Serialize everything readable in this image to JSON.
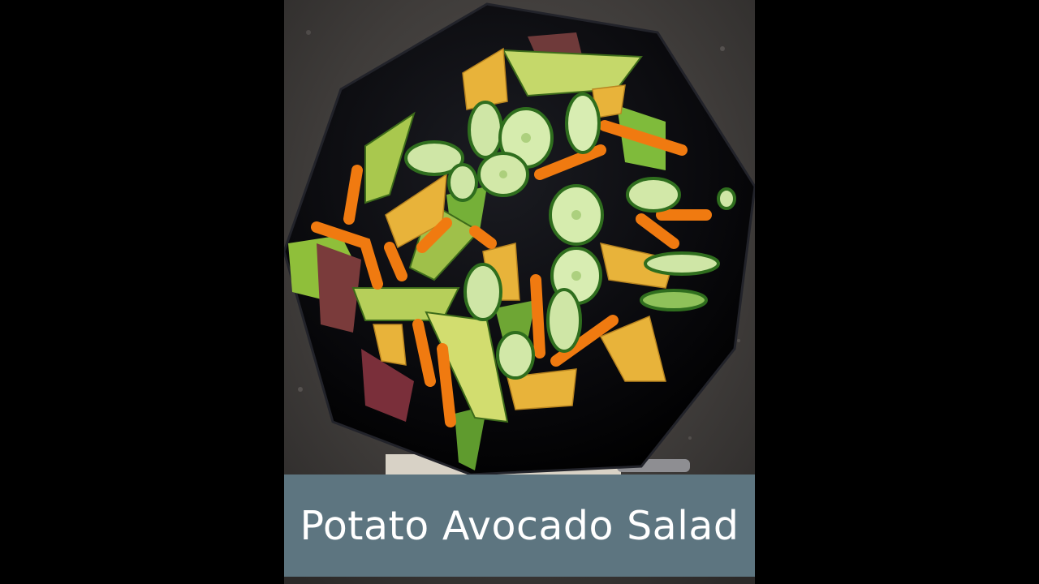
{
  "caption": {
    "title": "Potato Avocado Salad"
  },
  "colors": {
    "background": "#000000",
    "caption_bar": "#5d7580",
    "caption_text": "#ffffff",
    "countertop": "#3c3a38",
    "plate": "#0a0a0c"
  },
  "scene": {
    "subject": "salad-on-black-octagonal-plate",
    "ingredients": [
      "cucumber",
      "avocado",
      "orange-bell-pepper",
      "potato",
      "mixed-greens"
    ]
  }
}
